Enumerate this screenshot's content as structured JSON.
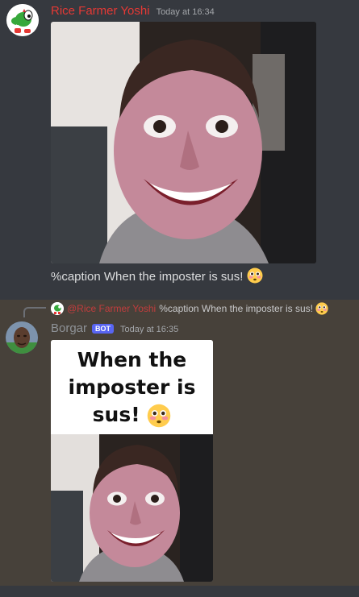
{
  "message1": {
    "username": "Rice Farmer Yoshi",
    "timestamp": "Today at 16:34",
    "content": "%caption When the imposter is sus!",
    "avatar_icon": "yoshi-avatar-icon",
    "image_icon": "grinning-face-photo",
    "emoji": "flushed-face-emoji"
  },
  "message2": {
    "reply": {
      "username": "@Rice Farmer Yoshi",
      "content": "%caption When the imposter is sus!"
    },
    "username": "Borgar",
    "bot_tag": "BOT",
    "timestamp": "Today at 16:35",
    "caption_text": "When the imposter is sus!",
    "avatar_icon": "borgar-avatar-icon"
  },
  "colors": {
    "background": "#36393f",
    "highlight": "#47413a",
    "username_red": "#e53935",
    "bot_blurple": "#5865f2"
  }
}
